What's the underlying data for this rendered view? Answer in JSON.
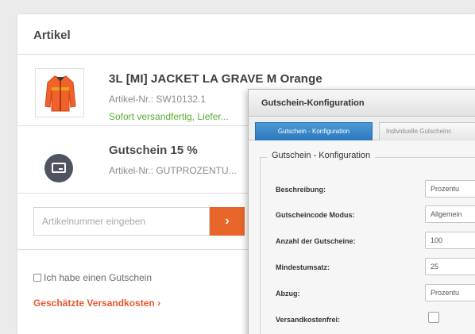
{
  "cart": {
    "section_title": "Artikel",
    "products": [
      {
        "title": "3L [MI] JACKET LA GRAVE M Orange",
        "article_nr": "Artikel-Nr.: SW10132.1",
        "availability": "Sofort versandfertig, Liefer..."
      },
      {
        "title": "Gutschein 15 %",
        "article_nr": "Artikel-Nr.: GUTPROZENTU..."
      }
    ],
    "article_input_placeholder": "Artikelnummer eingeben",
    "article_submit_label": "›",
    "voucher_checkbox_label": "Ich habe einen Gutschein",
    "shipping_link": "Geschätzte Versandkosten ›"
  },
  "dialog": {
    "title": "Gutschein-Konfiguration",
    "tabs": [
      {
        "label": "Gutschein - Konfiguration",
        "active": true
      },
      {
        "label": "Individuelle Gutscheinc",
        "active": false
      }
    ],
    "fieldset_legend": "Gutschein - Konfiguration",
    "fields": [
      {
        "label": "Beschreibung:",
        "value": "Prozentu"
      },
      {
        "label": "Gutscheincode Modus:",
        "value": "Allgemein"
      },
      {
        "label": "Anzahl der Gutscheine:",
        "value": "100"
      },
      {
        "label": "Mindestumsatz:",
        "value": "25"
      },
      {
        "label": "Abzug:",
        "value": "Prozentu"
      },
      {
        "label": "Versandkostenfrei:",
        "checked": false
      }
    ]
  },
  "icons": {
    "product_thumbnail": "orange-jacket-image",
    "voucher": "voucher-card-icon",
    "checkbox": "checkbox-icon"
  },
  "colors": {
    "accent_orange": "#e8662a",
    "link_orange": "#e4572e",
    "stock_green": "#5aad2e",
    "tab_blue": "#2c78bd",
    "voucher_icon_bg": "#4e5360"
  }
}
